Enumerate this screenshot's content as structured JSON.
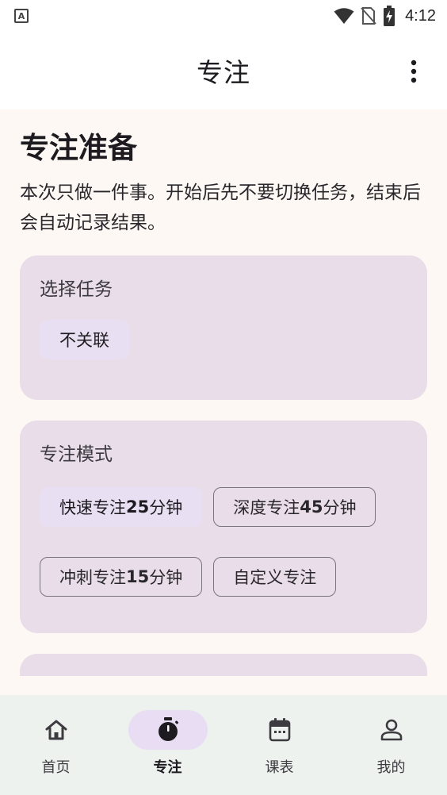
{
  "status_bar": {
    "time": "4:12",
    "left_icon_letter": "A"
  },
  "app_bar": {
    "title": "专注"
  },
  "main": {
    "heading": "专注准备",
    "description": "本次只做一件事。开始后先不要切换任务，结束后会自动记录结果。",
    "task_card": {
      "label": "选择任务",
      "chips": [
        {
          "label": "不关联",
          "selected": true
        }
      ]
    },
    "mode_card": {
      "label": "专注模式",
      "options": [
        {
          "name": "快速专注 ",
          "minutes": "25",
          "unit": "分钟",
          "selected": true
        },
        {
          "name": "深度专注 ",
          "minutes": "45",
          "unit": "分钟",
          "selected": false
        },
        {
          "name": "冲刺专注 ",
          "minutes": "15",
          "unit": "分钟",
          "selected": false
        },
        {
          "name": "自定义专注",
          "selected": false
        }
      ]
    }
  },
  "bottom_nav": {
    "items": [
      {
        "label": "首页",
        "icon": "home-icon"
      },
      {
        "label": "专注",
        "icon": "stopwatch-icon",
        "active": true
      },
      {
        "label": "课表",
        "icon": "calendar-icon"
      },
      {
        "label": "我的",
        "icon": "person-icon"
      }
    ]
  },
  "colors": {
    "accent_container": "#e8ddf3",
    "card_background": "#e8dde8",
    "page_background": "#fdf8f4",
    "nav_background": "#edf2ef"
  }
}
